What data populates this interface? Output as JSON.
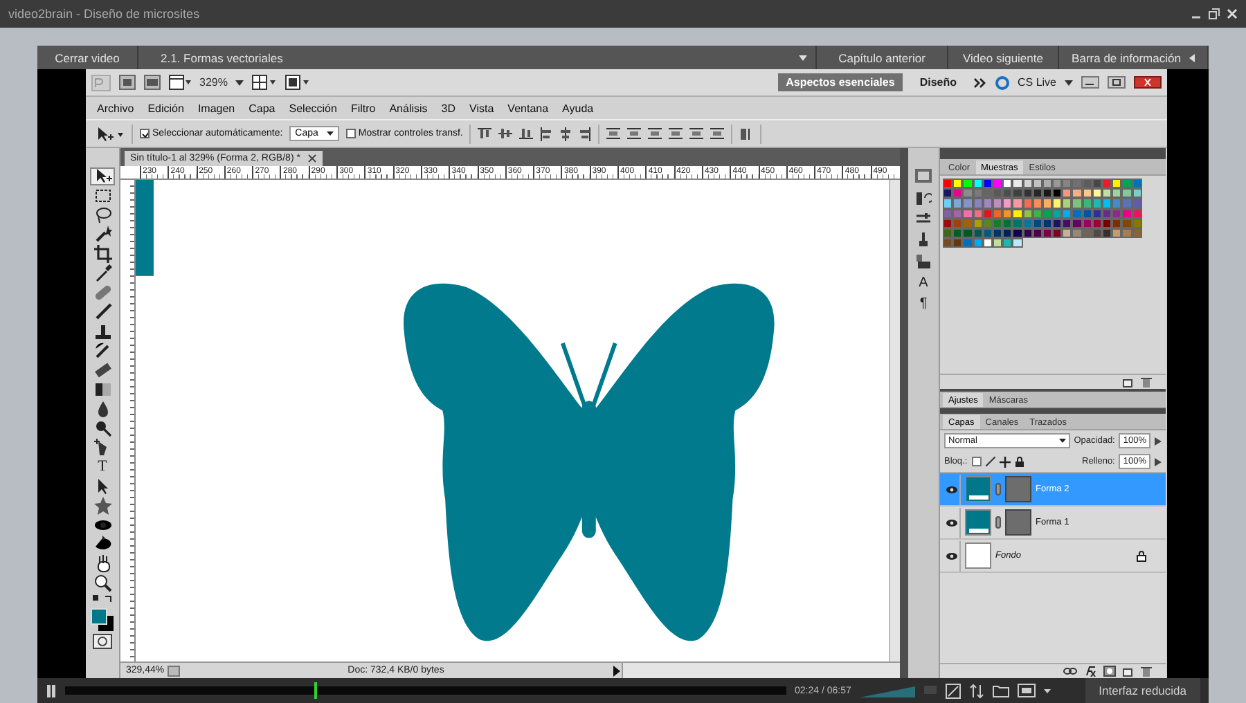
{
  "window": {
    "title": "video2brain - Diseño de microsites"
  },
  "player": {
    "close": "Cerrar video",
    "chapter": "2.1. Formas vectoriales",
    "previous": "Capítulo anterior",
    "next": "Video siguiente",
    "info_bar": "Barra de información"
  },
  "photoshop": {
    "app_bar": {
      "zoom": "329%",
      "workspaces": [
        {
          "label": "Aspectos esenciales",
          "selected": true
        },
        {
          "label": "Diseño",
          "selected": false
        }
      ],
      "cs_live": "CS Live"
    },
    "menu": [
      "Archivo",
      "Edición",
      "Imagen",
      "Capa",
      "Selección",
      "Filtro",
      "Análisis",
      "3D",
      "Vista",
      "Ventana",
      "Ayuda"
    ],
    "options": {
      "auto_select": {
        "label": "Seleccionar automáticamente:",
        "checked": true
      },
      "auto_select_target": "Capa",
      "transform_controls": {
        "label": "Mostrar controles transf.",
        "checked": false
      }
    },
    "type_tool": "T",
    "document": {
      "tab": "Sin título-1 al 329% (Forma 2, RGB/8) *",
      "ruler": [
        "230",
        "240",
        "250",
        "260",
        "270",
        "280",
        "290",
        "300",
        "310",
        "320",
        "330",
        "340",
        "350",
        "360",
        "370",
        "380",
        "390",
        "400",
        "410",
        "420",
        "430",
        "440",
        "450",
        "460",
        "470",
        "480",
        "490"
      ],
      "zoom": "329,44%",
      "info": "Doc: 732,4 KB/0 bytes"
    },
    "side_glyphs": [
      "A",
      "¶"
    ],
    "swatches_panel": {
      "tabs": [
        {
          "label": "Color",
          "selected": false
        },
        {
          "label": "Muestras",
          "selected": true
        },
        {
          "label": "Estilos",
          "selected": false
        }
      ],
      "swatches": [
        {
          "color": "#ff0000"
        },
        {
          "color": "#ffff00"
        },
        {
          "color": "#00ff00"
        },
        {
          "color": "#00ffff"
        },
        {
          "color": "#0000ff"
        },
        {
          "color": "#ff00ff"
        },
        {
          "color": "#ffffff"
        },
        {
          "color": "#ebebeb"
        },
        {
          "color": "#d6d6d6"
        },
        {
          "color": "#c2c2c2"
        },
        {
          "color": "#adadad"
        },
        {
          "color": "#999999"
        },
        {
          "color": "#858585"
        },
        {
          "color": "#707070"
        },
        {
          "color": "#5c5c5c"
        },
        {
          "color": "#474747"
        },
        {
          "color": "#ed1c24"
        },
        {
          "color": "#fff200"
        },
        {
          "color": "#00a651"
        },
        {
          "color": "#0072bc"
        },
        {
          "color": "#1b1464"
        },
        {
          "color": "#ec008c"
        },
        {
          "color": "#8c8c8c"
        },
        {
          "color": "#7a7a7a"
        },
        {
          "color": "#666666"
        },
        {
          "color": "#595959"
        },
        {
          "color": "#4d4d4d"
        },
        {
          "color": "#404040"
        },
        {
          "color": "#333333"
        },
        {
          "color": "#262626"
        },
        {
          "color": "#1a1a1a"
        },
        {
          "color": "#000000"
        },
        {
          "color": "#f7977a"
        },
        {
          "color": "#f9ad81"
        },
        {
          "color": "#fdc68a"
        },
        {
          "color": "#fff79a"
        },
        {
          "color": "#c4df9b"
        },
        {
          "color": "#a3d39c"
        },
        {
          "color": "#82ca9d"
        },
        {
          "color": "#7bcdc8"
        },
        {
          "color": "#6ecff6"
        },
        {
          "color": "#7ea7d8"
        },
        {
          "color": "#8493ca"
        },
        {
          "color": "#8882be"
        },
        {
          "color": "#a187be"
        },
        {
          "color": "#bc8dbf"
        },
        {
          "color": "#f49ac2"
        },
        {
          "color": "#f6989d"
        },
        {
          "color": "#f26c4f"
        },
        {
          "color": "#f68e55"
        },
        {
          "color": "#fbaf5c"
        },
        {
          "color": "#fff467"
        },
        {
          "color": "#acd372"
        },
        {
          "color": "#7cc576"
        },
        {
          "color": "#3bb878"
        },
        {
          "color": "#1abbb4"
        },
        {
          "color": "#00bff3"
        },
        {
          "color": "#438ccb"
        },
        {
          "color": "#5574b9"
        },
        {
          "color": "#605ca8"
        },
        {
          "color": "#855fa8"
        },
        {
          "color": "#a763a8"
        },
        {
          "color": "#f06ea9"
        },
        {
          "color": "#f26d7d"
        },
        {
          "color": "#e8101a"
        },
        {
          "color": "#f26522"
        },
        {
          "color": "#f7941d"
        },
        {
          "color": "#fff000"
        },
        {
          "color": "#8dc73f"
        },
        {
          "color": "#39b54a"
        },
        {
          "color": "#00a650"
        },
        {
          "color": "#00a99d"
        },
        {
          "color": "#00aeef"
        },
        {
          "color": "#0071bc"
        },
        {
          "color": "#0054a6"
        },
        {
          "color": "#2e3192"
        },
        {
          "color": "#662d91"
        },
        {
          "color": "#92278f"
        },
        {
          "color": "#eb008b"
        },
        {
          "color": "#ed145b"
        },
        {
          "color": "#9e0b0f"
        },
        {
          "color": "#a0410d"
        },
        {
          "color": "#a36209"
        },
        {
          "color": "#aba000"
        },
        {
          "color": "#598527"
        },
        {
          "color": "#197b30"
        },
        {
          "color": "#007236"
        },
        {
          "color": "#00746b"
        },
        {
          "color": "#0076a3"
        },
        {
          "color": "#004a80"
        },
        {
          "color": "#003471"
        },
        {
          "color": "#1b1463"
        },
        {
          "color": "#440e62"
        },
        {
          "color": "#630460"
        },
        {
          "color": "#9e005d"
        },
        {
          "color": "#9e0039"
        },
        {
          "color": "#790000"
        },
        {
          "color": "#7b2e00"
        },
        {
          "color": "#7d4900"
        },
        {
          "color": "#827b00"
        },
        {
          "color": "#406618"
        },
        {
          "color": "#005e20"
        },
        {
          "color": "#005826"
        },
        {
          "color": "#005952"
        },
        {
          "color": "#005b7f"
        },
        {
          "color": "#003663"
        },
        {
          "color": "#002157"
        },
        {
          "color": "#0d004c"
        },
        {
          "color": "#32004b"
        },
        {
          "color": "#4b0049"
        },
        {
          "color": "#7b0046"
        },
        {
          "color": "#7a0026"
        },
        {
          "color": "#c7b299"
        },
        {
          "color": "#998675"
        },
        {
          "color": "#736357"
        },
        {
          "color": "#534741"
        },
        {
          "color": "#362f2d"
        },
        {
          "color": "#c69c6d"
        },
        {
          "color": "#a67c52"
        },
        {
          "color": "#8c6239"
        },
        {
          "color": "#754c24"
        },
        {
          "color": "#603913"
        },
        {
          "color": "#0070bb"
        },
        {
          "color": "#00adee"
        },
        {
          "color": "#fefefe"
        },
        {
          "color": "#c3de9a"
        },
        {
          "color": "#1abab3"
        },
        {
          "color": "#bde8f5"
        }
      ]
    },
    "adjustments_panel": {
      "tabs": [
        {
          "label": "Ajustes",
          "selected": true
        },
        {
          "label": "Máscaras",
          "selected": false
        }
      ]
    },
    "layers_panel": {
      "tabs": [
        {
          "label": "Capas",
          "selected": true
        },
        {
          "label": "Canales",
          "selected": false
        },
        {
          "label": "Trazados",
          "selected": false
        }
      ],
      "blend_mode": "Normal",
      "opacity_label": "Opacidad:",
      "opacity": "100%",
      "lock_label": "Bloq.:",
      "fill_label": "Relleno:",
      "fill": "100%",
      "layers": [
        {
          "name": "Forma 2",
          "kind": "shape",
          "selected": true,
          "visible": true,
          "locked": false
        },
        {
          "name": "Forma 1",
          "kind": "shape",
          "selected": false,
          "visible": true,
          "locked": false
        },
        {
          "name": "Fondo",
          "kind": "background",
          "selected": false,
          "visible": true,
          "locked": true
        }
      ]
    }
  },
  "controls": {
    "progress": {
      "level": 0.345
    },
    "time": "02:24 / 06:57",
    "mode_button": "Interfaz reducida"
  }
}
